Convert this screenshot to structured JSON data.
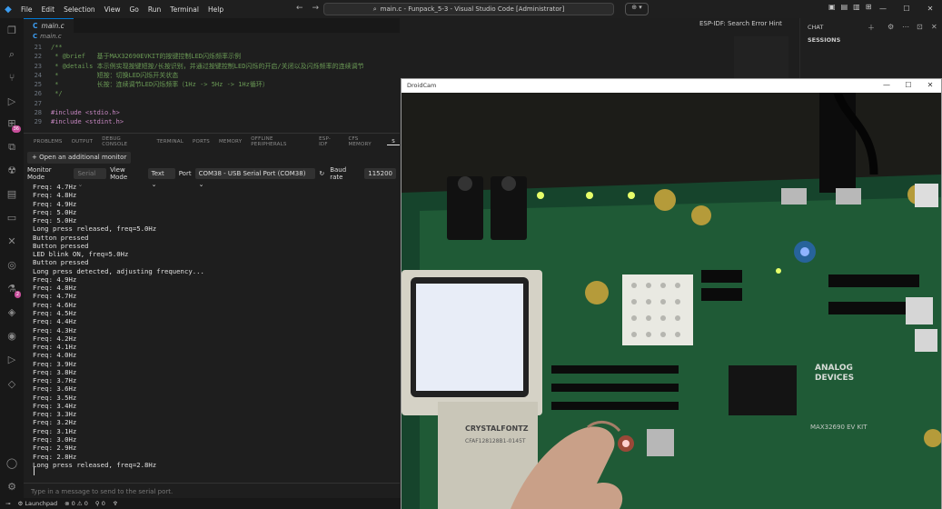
{
  "titlebar": {
    "menu": [
      "File",
      "Edit",
      "Selection",
      "View",
      "Go",
      "Run",
      "Terminal",
      "Help"
    ],
    "command_center": "main.c - Funpack_5-3 - Visual Studio Code [Administrator]"
  },
  "editor": {
    "tab": "main.c",
    "breadcrumb": "main.c",
    "lines": [
      {
        "n": "21",
        "t": "/**",
        "cls": "cm"
      },
      {
        "n": "22",
        "t": " * @brief   基于MAX32690EVKIT的按键控制LED闪烁频率示例",
        "cls": "cm"
      },
      {
        "n": "23",
        "t": " * @details 本示例实现按键短按/长按识别，并通过按键控制LED闪烁的开启/关闭以及闪烁频率的连续调节",
        "cls": "cm"
      },
      {
        "n": "24",
        "t": " *          短按：切换LED闪烁开关状态",
        "cls": "cm"
      },
      {
        "n": "25",
        "t": " *          长按：连续调节LED闪烁频率（1Hz -> 5Hz -> 1Hz循环）",
        "cls": "cm"
      },
      {
        "n": "26",
        "t": " */",
        "cls": "cm"
      },
      {
        "n": "27",
        "t": "",
        "cls": ""
      },
      {
        "n": "28",
        "t": "#include <stdio.h>",
        "cls": "kw"
      },
      {
        "n": "29",
        "t": "#include <stdint.h>",
        "cls": "kw"
      }
    ],
    "right_status": "ESP-IDF: Search Error Hint"
  },
  "chat": {
    "title": "CHAT",
    "sessions": "SESSIONS"
  },
  "panel": {
    "tabs": [
      "PROBLEMS",
      "OUTPUT",
      "DEBUG CONSOLE",
      "TERMINAL",
      "PORTS",
      "MEMORY",
      "OFFLINE PERIPHERALS",
      "ESP-IDF",
      "CFS MEMORY",
      "S"
    ],
    "active_tab": "S",
    "add_monitor": "+ Open an additional monitor",
    "monitor_mode_label": "Monitor Mode",
    "monitor_mode": "Serial",
    "view_mode_label": "View Mode",
    "view_mode": "Text",
    "port_label": "Port",
    "port": "COM38 - USB Serial Port (COM38)",
    "baud_label": "Baud rate",
    "baud": "115200",
    "output": [
      "Freq: 4.7Hz",
      "Freq: 4.8Hz",
      "Freq: 4.9Hz",
      "Freq: 5.0Hz",
      "Freq: 5.0Hz",
      "Long press released, freq=5.0Hz",
      "Button pressed",
      "Button pressed",
      "LED blink ON, freq=5.0Hz",
      "Button pressed",
      "Long press detected, adjusting frequency...",
      "Freq: 4.9Hz",
      "Freq: 4.8Hz",
      "Freq: 4.7Hz",
      "Freq: 4.6Hz",
      "Freq: 4.5Hz",
      "Freq: 4.4Hz",
      "Freq: 4.3Hz",
      "Freq: 4.2Hz",
      "Freq: 4.1Hz",
      "Freq: 4.0Hz",
      "Freq: 3.9Hz",
      "Freq: 3.8Hz",
      "Freq: 3.7Hz",
      "Freq: 3.6Hz",
      "Freq: 3.5Hz",
      "Freq: 3.4Hz",
      "Freq: 3.3Hz",
      "Freq: 3.2Hz",
      "Freq: 3.1Hz",
      "Freq: 3.0Hz",
      "Freq: 2.9Hz",
      "Freq: 2.8Hz",
      "Long press released, freq=2.8Hz"
    ],
    "input_placeholder": "Type in a message to send to the serial port."
  },
  "statusbar": {
    "launchpad": "Launchpad",
    "errors": "0",
    "warnings": "0"
  },
  "droidcam": {
    "title": "DroidCam",
    "board_text": [
      "ANALOG",
      "DEVICES",
      "MAX32690 EV KIT",
      "CRYSTALFONTZ",
      "CFAF128128B1-0145T"
    ]
  }
}
